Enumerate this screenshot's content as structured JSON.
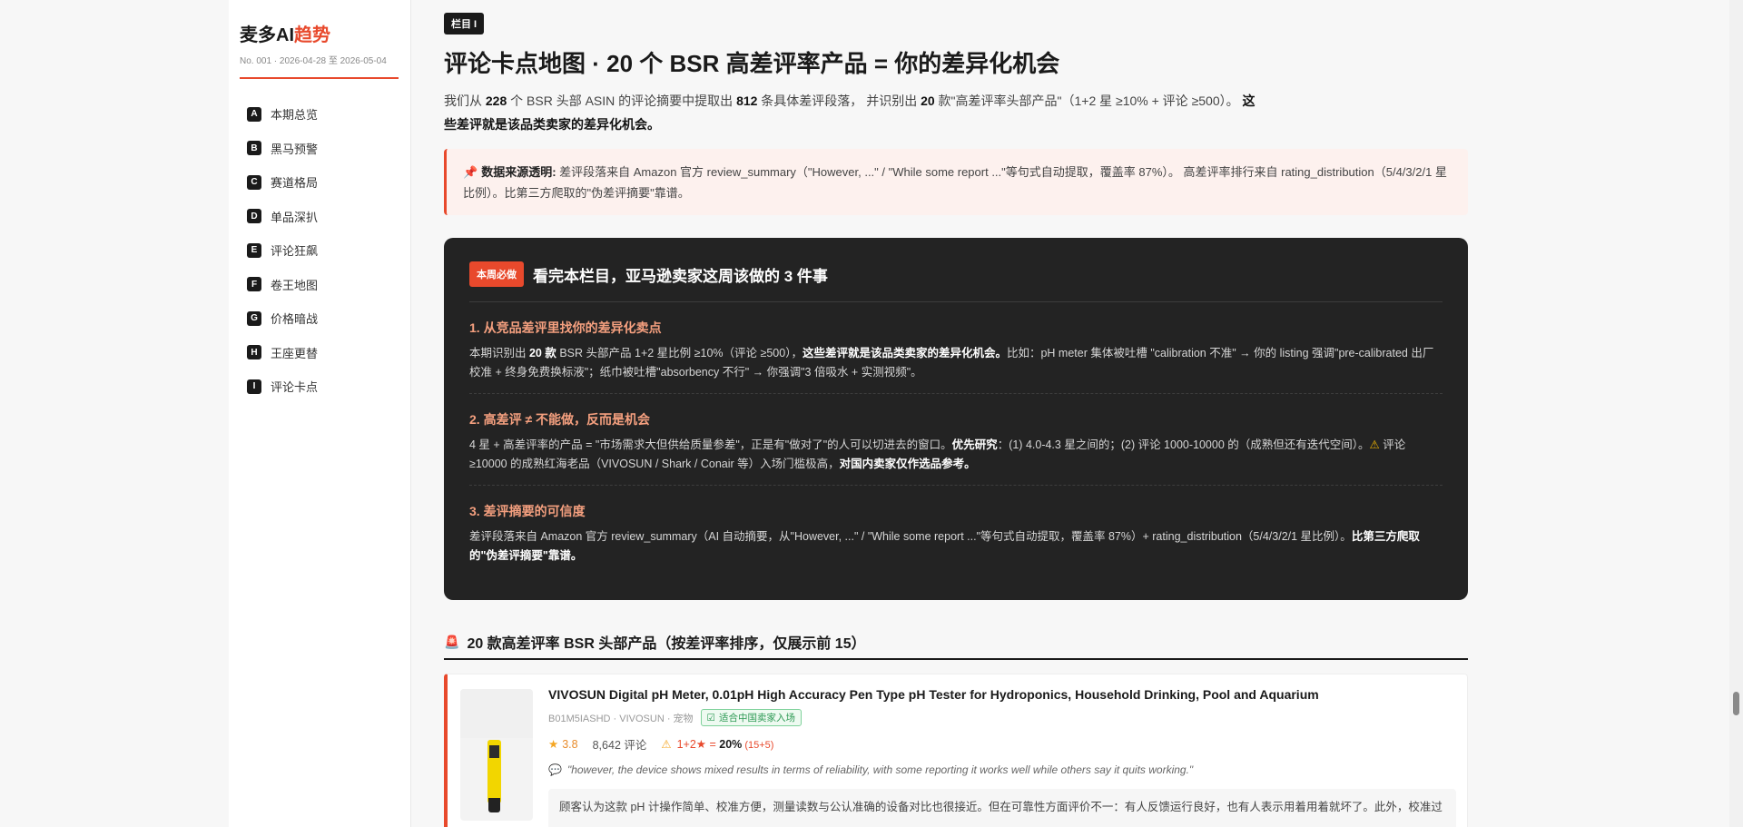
{
  "sidebar": {
    "brand_a": "麦多AI",
    "brand_b": "趋势",
    "issue": "No. 001 · 2026-04-28 至 2026-05-04",
    "items": [
      {
        "badge": "A",
        "label": "本期总览"
      },
      {
        "badge": "B",
        "label": "黑马预警"
      },
      {
        "badge": "C",
        "label": "赛道格局"
      },
      {
        "badge": "D",
        "label": "单品深扒"
      },
      {
        "badge": "E",
        "label": "评论狂飙"
      },
      {
        "badge": "F",
        "label": "卷王地图"
      },
      {
        "badge": "G",
        "label": "价格暗战"
      },
      {
        "badge": "H",
        "label": "王座更替"
      },
      {
        "badge": "I",
        "label": "评论卡点"
      }
    ]
  },
  "main": {
    "tag": "栏目 I",
    "title": "评论卡点地图 · 20 个 BSR 高差评率产品 = 你的差异化机会",
    "intro": {
      "p1": "我们从 ",
      "n1": "228",
      "p2": " 个 BSR 头部 ASIN 的评论摘要中提取出 ",
      "n2": "812",
      "p3": " 条具体差评段落， 并识别出 ",
      "n3": "20",
      "p4": " 款\"高差评率头部产品\"（1+2 星 ≥10% + 评论 ≥500）。 ",
      "bold": "这些差评就是该品类卖家的差异化机会。"
    },
    "notice": {
      "pin": "📌",
      "label": "数据来源透明:",
      "text": " 差评段落来自 Amazon 官方 review_summary（\"However, ...\" / \"While some report ...\"等句式自动提取，覆盖率 87%）。 高差评率排行来自 rating_distribution（5/4/3/2/1 星比例）。比第三方爬取的\"伪差评摘要\"靠谱。"
    },
    "dark": {
      "badge": "本周必做",
      "title": "看完本栏目，亚马逊卖家这周该做的 3 件事",
      "points": [
        {
          "h": "1. 从竞品差评里找你的差异化卖点",
          "a": "本期识别出 ",
          "b": "20 款",
          "c": " BSR 头部产品 1+2 星比例 ≥10%（评论 ≥500），",
          "d": "这些差评就是该品类卖家的差异化机会。",
          "e": "比如：pH meter 集体被吐槽 \"calibration 不准\" → 你的 listing 强调\"pre-calibrated 出厂校准 + 终身免费换标液\"；纸巾被吐槽\"absorbency 不行\" → 你强调\"3 倍吸水 + 实测视频\"。"
        },
        {
          "h": "2. 高差评 ≠ 不能做，反而是机会",
          "a": "4 星 + 高差评率的产品 = \"市场需求大但供给质量参差\"，正是有\"做对了\"的人可以切进去的窗口。",
          "b": "优先研究",
          "c": "：(1) 4.0-4.3 星之间的；(2) 评论 1000-10000 的（成熟但还有迭代空间）。",
          "warn": "⚠",
          "d": " 评论 ≥10000 的成熟红海老品（VIVOSUN / Shark / Conair 等）入场门槛极高，",
          "e": "对国内卖家仅作选品参考。"
        },
        {
          "h": "3. 差评摘要的可信度",
          "a": "差评段落来自 Amazon 官方 review_summary（AI 自动摘要，从\"However, ...\" / \"While some report ...\"等句式自动提取，覆盖率 87%）+ rating_distribution（5/4/3/2/1 星比例）。",
          "b": "比第三方爬取的\"伪差评摘要\"靠谱。"
        }
      ]
    },
    "section": {
      "icon": "🚨",
      "title": "20 款高差评率 BSR 头部产品（按差评率排序，仅展示前 15）"
    },
    "product": {
      "title": "VIVOSUN Digital pH Meter, 0.01pH High Accuracy Pen Type pH Tester for Hydroponics, Household Drinking, Pool and Aquarium",
      "meta": "B01M5IASHD · VIVOSUN · 宠物",
      "fit": "适合中国卖家入场",
      "rating": "3.8",
      "reviews": "8,642 评论",
      "neg_label": "1+2★ = ",
      "neg_pct": "20%",
      "neg_sub": " (15+5)",
      "quote": "\"however, the device shows mixed results in terms of reliability, with some reporting it works well while others say it quits working.\"",
      "summary": "顾客认为这款 pH 计操作简单、校准方便，测量读数与公认准确的设备对比也很接近。但在可靠性方面评价不一：有人反馈运行良好，也有人表示用着用着就坏了。此外，校准过"
    }
  },
  "colors": {
    "accent": "#e8492c",
    "dark_panel": "#232323"
  }
}
